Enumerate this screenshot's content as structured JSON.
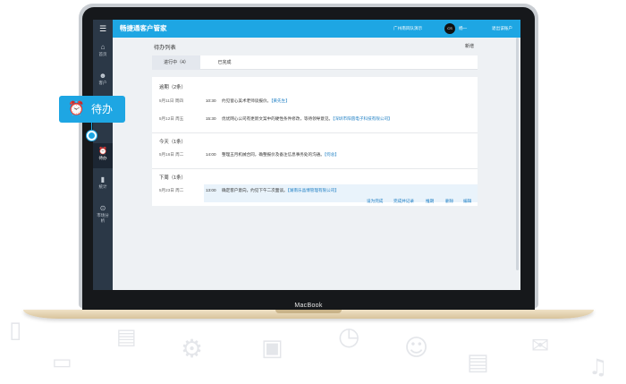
{
  "app": {
    "title": "畅捷通客户管家",
    "org": "广州南风队演示",
    "avatar_text": "CS",
    "user": "杨一",
    "logout": "退出该账户"
  },
  "sidebar": {
    "items": [
      {
        "label": "首页",
        "icon": "home-icon",
        "glyph": "⌂"
      },
      {
        "label": "客户",
        "icon": "user-icon",
        "glyph": "☻"
      },
      {
        "label": "待办",
        "icon": "alarm-clock-icon",
        "glyph": "⏰"
      },
      {
        "label": "统计",
        "icon": "bar-chart-icon",
        "glyph": "▮"
      },
      {
        "label": "市场分析",
        "icon": "search-analysis-icon",
        "glyph": "⊙"
      }
    ],
    "active_index": 2
  },
  "page": {
    "title": "待办列表",
    "add_label": "新增"
  },
  "tabs": [
    {
      "label": "进行中（4）",
      "active": true
    },
    {
      "label": "已完成",
      "active": false
    }
  ],
  "groups": [
    {
      "title": "逾期（2条）",
      "rows": [
        {
          "date": "5月11日 周四",
          "time": "10:30",
          "text": "约见窗心美术老师谈报价。",
          "tag": "【黄先生】"
        },
        {
          "date": "5月12日 周五",
          "time": "15:30",
          "text": "优优网心公司有更新文案中的硬性条件修改，等待领导意见。",
          "tag": "【深圳市阳茵电子科技有限公司】"
        }
      ]
    },
    {
      "title": "今天（1条）",
      "rows": [
        {
          "date": "5月16日 周二",
          "time": "14:00",
          "text": "整理五月机械合同，确整报价及备注信息事务处的沟通。",
          "tag": "【何总】"
        }
      ]
    },
    {
      "title": "下周（1条）",
      "rows": [
        {
          "date": "5月23日 周二",
          "time": "13:00",
          "text": "确定客户意向，约见下午二次面谈。",
          "tag": "【湖南乐晶博管理有限公司】"
        }
      ]
    }
  ],
  "row_actions": [
    "设为完成",
    "完成并记录",
    "推期",
    "删除",
    "编辑"
  ],
  "callout": {
    "label": "待办",
    "icon": "alarm-clock-icon"
  },
  "device": {
    "brand": "MacBook"
  },
  "colors": {
    "accent": "#1ea6e3",
    "sidebar": "#2b3847",
    "link": "#1e7fc4"
  }
}
